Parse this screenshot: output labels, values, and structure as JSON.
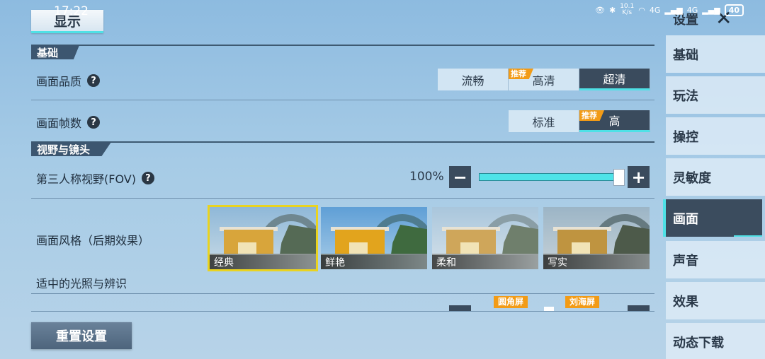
{
  "status_bar": {
    "time": "17:22",
    "net_speed_top": "10.1",
    "net_speed_unit": "K/s",
    "signal_1": "4G",
    "signal_2": "4G",
    "battery": "40"
  },
  "header": {
    "display_tab": "显示"
  },
  "sections": {
    "basic": "基础",
    "view_camera": "视野与镜头"
  },
  "quality": {
    "label": "画面品质",
    "options": [
      "流畅",
      "高清",
      "超清"
    ],
    "recommended_badge": "推荐",
    "selected": "超清"
  },
  "framerate": {
    "label": "画面帧数",
    "options": [
      "标准",
      "高"
    ],
    "recommended_badge": "推荐",
    "selected": "高"
  },
  "fov": {
    "label": "第三人称视野(FOV)",
    "value_text": "100%",
    "value": 1.0,
    "minus": "−",
    "plus": "+"
  },
  "style": {
    "label": "画面风格（后期效果）",
    "description": "适中的光照与辨识",
    "options": [
      "经典",
      "鲜艳",
      "柔和",
      "写实"
    ],
    "selected": "经典"
  },
  "screen_adapt": {
    "badge_1": "圆角屏",
    "badge_2": "刘海屏"
  },
  "reset_label": "重置设置",
  "sidebar": {
    "title": "设置",
    "items": [
      "基础",
      "玩法",
      "操控",
      "灵敏度",
      "画面",
      "声音",
      "效果",
      "动态下载"
    ],
    "active": "画面"
  },
  "colors": {
    "accent": "#4fe1e6",
    "active_bg": "#3a4b5d",
    "badge": "#f29b16",
    "selected_outline": "#e9d320"
  }
}
